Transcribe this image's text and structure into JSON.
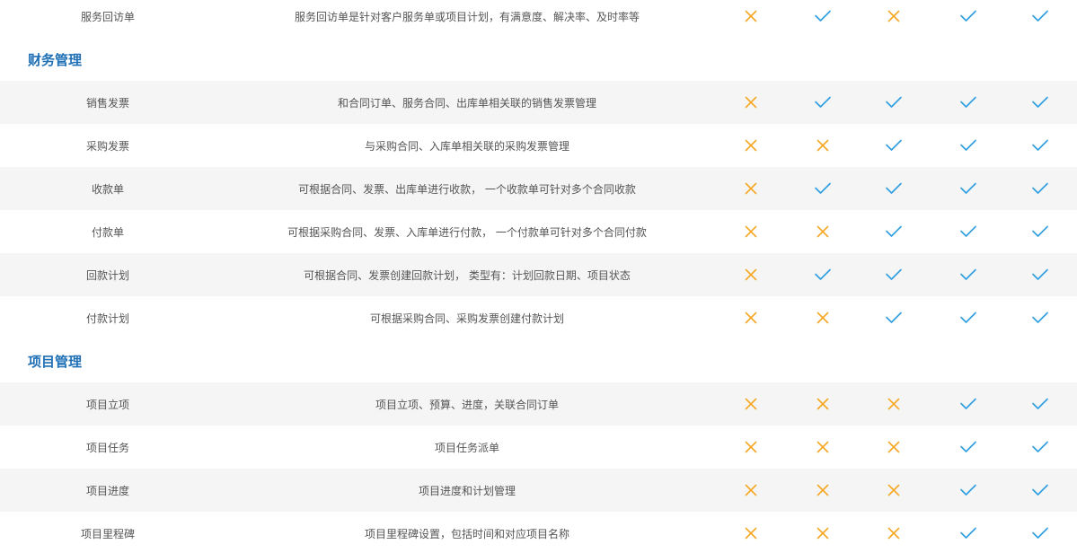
{
  "colors": {
    "section_title": "#1f6fb5",
    "x_mark": "#f5a623",
    "check_mark": "#2d9ee0",
    "row_shade": "#f5f5f5",
    "text": "#555555"
  },
  "rows": [
    {
      "kind": "item",
      "shade": false,
      "name": "服务回访单",
      "desc": "服务回访单是针对客户服务单或项目计划，有满意度、解决率、及时率等",
      "marks": [
        "x",
        "check",
        "x",
        "check",
        "check"
      ]
    },
    {
      "kind": "section",
      "title": "财务管理"
    },
    {
      "kind": "item",
      "shade": true,
      "name": "销售发票",
      "desc": "和合同订单、服务合同、出库单相关联的销售发票管理",
      "marks": [
        "x",
        "check",
        "check",
        "check",
        "check"
      ]
    },
    {
      "kind": "item",
      "shade": false,
      "name": "采购发票",
      "desc": "与采购合同、入库单相关联的采购发票管理",
      "marks": [
        "x",
        "x",
        "check",
        "check",
        "check"
      ]
    },
    {
      "kind": "item",
      "shade": true,
      "name": "收款单",
      "desc": "可根据合同、发票、出库单进行收款， 一个收款单可针对多个合同收款",
      "marks": [
        "x",
        "check",
        "check",
        "check",
        "check"
      ]
    },
    {
      "kind": "item",
      "shade": false,
      "name": "付款单",
      "desc": "可根据采购合同、发票、入库单进行付款， 一个付款单可针对多个合同付款",
      "marks": [
        "x",
        "x",
        "check",
        "check",
        "check"
      ]
    },
    {
      "kind": "item",
      "shade": true,
      "name": "回款计划",
      "desc": "可根据合同、发票创建回款计划， 类型有：计划回款日期、项目状态",
      "marks": [
        "x",
        "check",
        "check",
        "check",
        "check"
      ]
    },
    {
      "kind": "item",
      "shade": false,
      "name": "付款计划",
      "desc": "可根据采购合同、采购发票创建付款计划",
      "marks": [
        "x",
        "x",
        "check",
        "check",
        "check"
      ]
    },
    {
      "kind": "section",
      "title": "项目管理"
    },
    {
      "kind": "item",
      "shade": true,
      "name": "项目立项",
      "desc": "项目立项、预算、进度，关联合同订单",
      "marks": [
        "x",
        "x",
        "x",
        "check",
        "check"
      ]
    },
    {
      "kind": "item",
      "shade": false,
      "name": "项目任务",
      "desc": "项目任务派单",
      "marks": [
        "x",
        "x",
        "x",
        "check",
        "check"
      ]
    },
    {
      "kind": "item",
      "shade": true,
      "name": "项目进度",
      "desc": "项目进度和计划管理",
      "marks": [
        "x",
        "x",
        "x",
        "check",
        "check"
      ]
    },
    {
      "kind": "item",
      "shade": false,
      "name": "项目里程碑",
      "desc": "项目里程碑设置，包括时间和对应项目名称",
      "marks": [
        "x",
        "x",
        "x",
        "check",
        "check"
      ]
    }
  ]
}
